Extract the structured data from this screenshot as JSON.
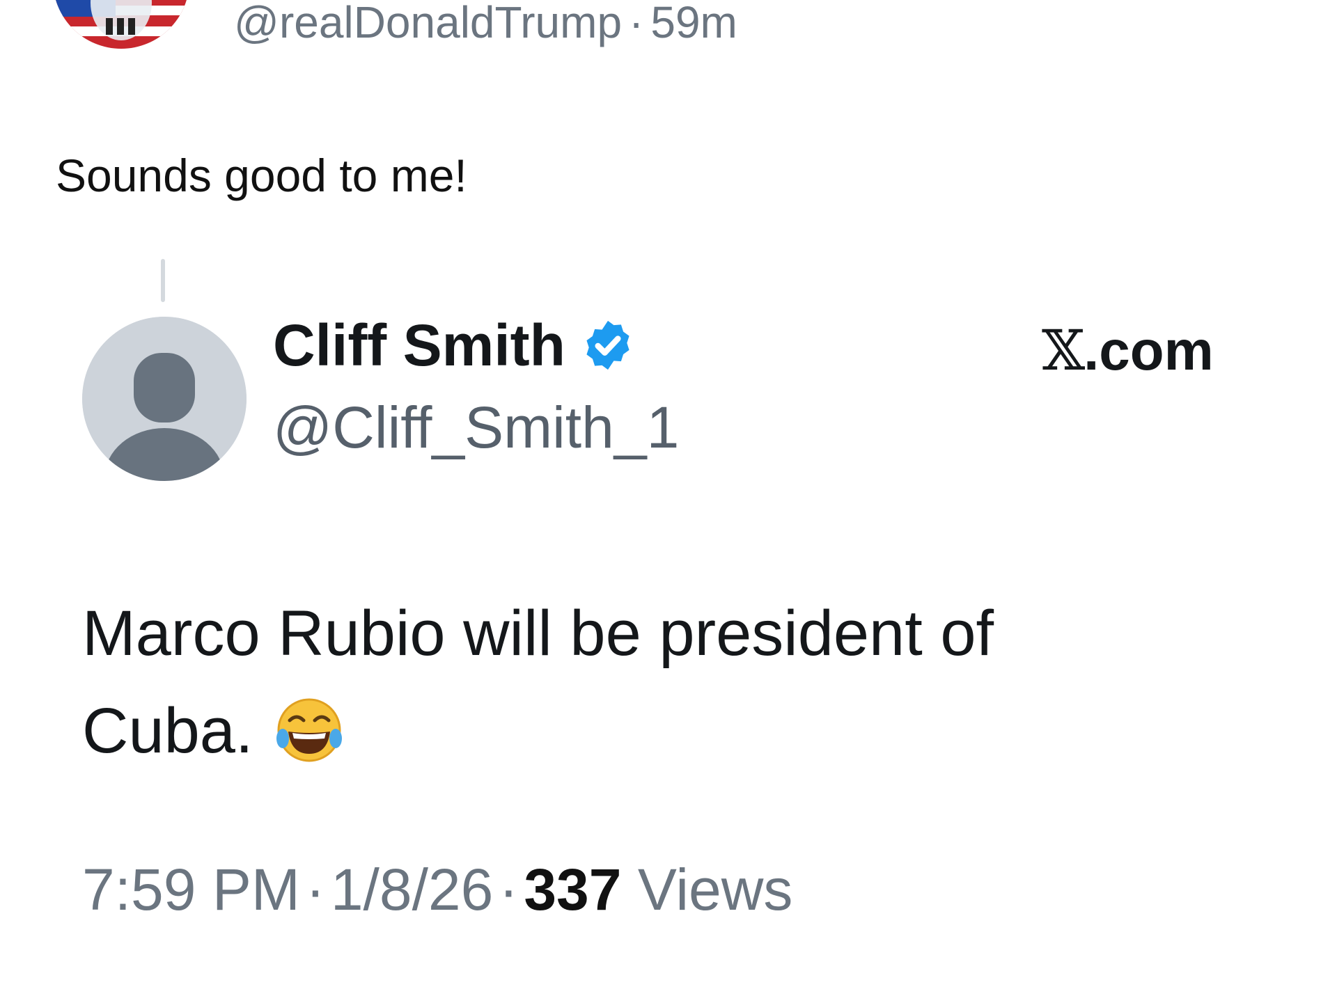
{
  "post": {
    "handle": "@realDonaldTrump",
    "separator": "·",
    "age": "59m",
    "text": "Sounds good to me!",
    "avatar_icon": "flag-skull-avatar-icon"
  },
  "quoted": {
    "name": "Cliff Smith",
    "verified_icon": "verified-badge-icon",
    "handle": "@Cliff_Smith_1",
    "source_mark": "𝕏",
    "source_suffix": ".com",
    "text_line1": "Marco Rubio will be president of",
    "text_line2": "Cuba.",
    "emoji_icon": "face-with-tears-of-joy-icon",
    "time": "7:59 PM",
    "sep": "·",
    "date": "1/8/26",
    "views_count": "337",
    "views_label": "Views"
  },
  "colors": {
    "verified_blue": "#1d9bf0",
    "meta_gray": "#6b7580",
    "text_dark": "#14171a",
    "avatar_placeholder": "#cdd3da"
  }
}
